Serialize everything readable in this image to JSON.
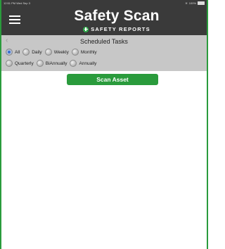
{
  "status_bar": {
    "time": "12:51 PM  Wed Sep 3",
    "battery": "100%"
  },
  "header": {
    "title": "Safety Scan",
    "brand": "SAFETY REPORTS"
  },
  "section": {
    "back": "‹",
    "title": "Scheduled Tasks"
  },
  "filters": {
    "selected": "All",
    "row1": [
      {
        "label": "All",
        "selected": true
      },
      {
        "label": "Daily",
        "selected": false
      },
      {
        "label": "Weekly",
        "selected": false
      },
      {
        "label": "Monthly",
        "selected": false
      }
    ],
    "row2": [
      {
        "label": "Quarterly",
        "selected": false
      },
      {
        "label": "BiAnnually",
        "selected": false
      },
      {
        "label": "Annually",
        "selected": false
      }
    ]
  },
  "actions": {
    "scan_asset": "Scan Asset"
  },
  "colors": {
    "accent": "#2a9b3c",
    "header_bg": "#3a3a3a",
    "subheader_bg": "#c7c7c7",
    "radio_selected": "#3b6fd1"
  }
}
